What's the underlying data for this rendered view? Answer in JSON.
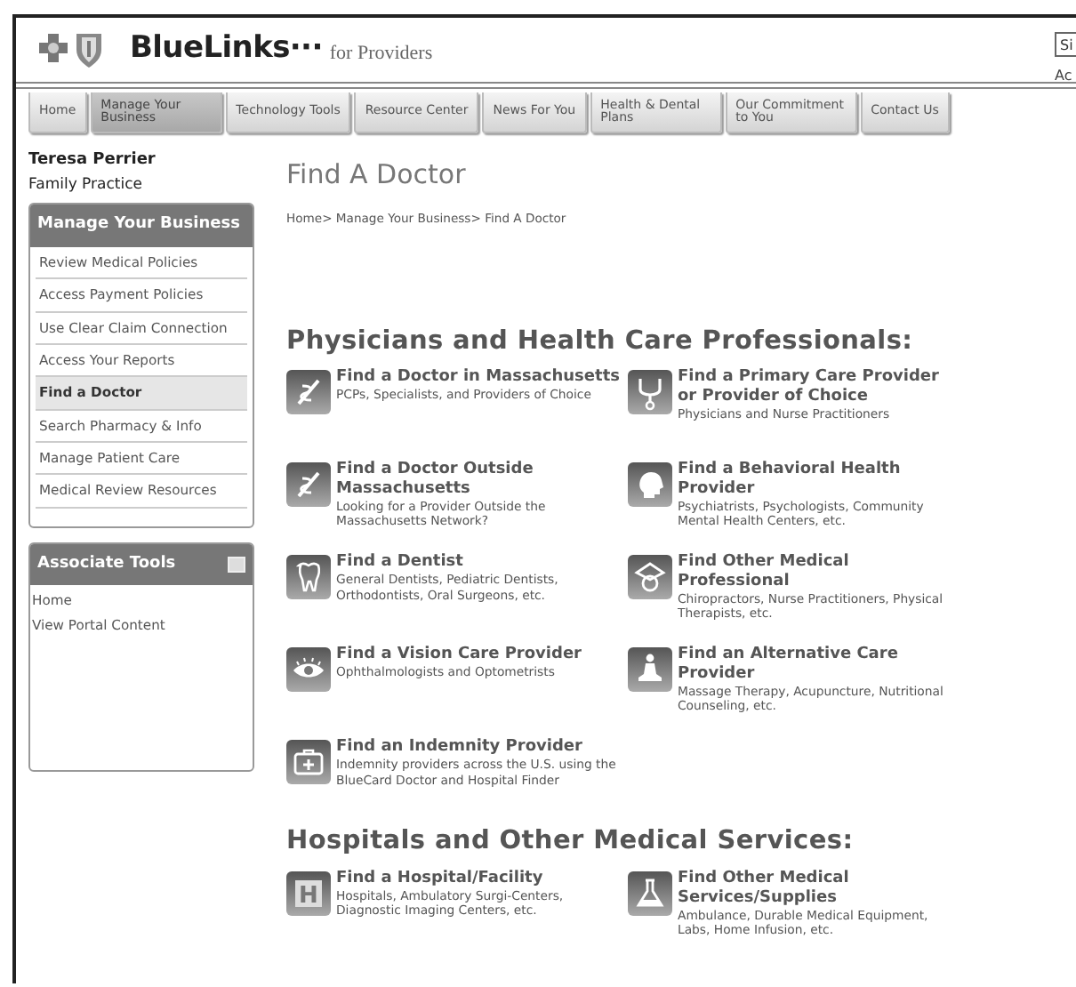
{
  "header": {
    "brand": "BlueLinks···",
    "tagline": "for Providers",
    "search_field": {
      "value": "Si"
    },
    "header_link": "Ac"
  },
  "nav": [
    {
      "label": "Home",
      "selected": false
    },
    {
      "label": "Manage Your Business",
      "selected": true
    },
    {
      "label": "Technology Tools",
      "selected": false
    },
    {
      "label": "Resource Center",
      "selected": false
    },
    {
      "label": "News For You",
      "selected": false
    },
    {
      "label": "Health & Dental Plans",
      "selected": false
    },
    {
      "label": "Our Commitment to You",
      "selected": false
    },
    {
      "label": "Contact Us",
      "selected": false
    }
  ],
  "user": {
    "name": "Teresa Perrier",
    "practice": "Family Practice"
  },
  "sidebar_panels": [
    {
      "title": "Manage Your Business",
      "collapsible": false,
      "items": [
        {
          "label": "Review Medical Policies",
          "selected": false
        },
        {
          "label": "Access Payment Policies",
          "selected": false
        },
        {
          "label": "Use Clear Claim Connection",
          "selected": false
        },
        {
          "label": "Access Your Reports",
          "selected": false
        },
        {
          "label": "Find a Doctor",
          "selected": true
        },
        {
          "label": "Search Pharmacy & Info",
          "selected": false
        },
        {
          "label": "Manage Patient Care",
          "selected": false
        },
        {
          "label": "Medical Review Resources",
          "selected": false
        }
      ]
    },
    {
      "title": "Associate Tools",
      "collapsible": true,
      "items": [
        {
          "label": "Home",
          "selected": false
        },
        {
          "label": "View Portal Content",
          "selected": false
        }
      ]
    }
  ],
  "page": {
    "title": "Find A Doctor",
    "breadcrumb": "Home> Manage Your Business> Find A Doctor",
    "sections": [
      {
        "heading": "Physicians and Health Care Professionals:",
        "items": [
          {
            "title": "Find a Doctor in Massachusetts",
            "description": "PCPs, Specialists, and Providers of Choice"
          },
          {
            "title": "Find a Primary Care Provider or Provider of Choice",
            "description": "Physicians and Nurse Practitioners"
          },
          {
            "title": "Find a Doctor Outside Massachusetts",
            "description": "Looking for a Provider Outside the Massachusetts Network?"
          },
          {
            "title": "Find a Behavioral Health Provider",
            "description": "Psychiatrists, Psychologists, Community Mental Health Centers, etc."
          },
          {
            "title": "Find a Dentist",
            "description": "General Dentists, Pediatric Dentists, Orthodontists, Oral Surgeons, etc."
          },
          {
            "title": "Find Other Medical Professional",
            "description": "Chiropractors, Nurse Practitioners, Physical Therapists, etc."
          },
          {
            "title": "Find a Vision Care Provider",
            "description": "Ophthalmologists and Optometrists"
          },
          {
            "title": "Find an Alternative Care Provider",
            "description": "Massage Therapy, Acupuncture, Nutritional Counseling, etc."
          },
          {
            "title": "Find an Indemnity Provider",
            "description": "Indemnity providers across the U.S. using the BlueCard Doctor and Hospital Finder"
          }
        ]
      },
      {
        "heading": "Hospitals and Other Medical Services:",
        "items": [
          {
            "title": "Find a Hospital/Facility",
            "description": "Hospitals, Ambulatory Surgi-Centers, Diagnostic Imaging Centers, etc.",
            "icon_text": "H"
          },
          {
            "title": "Find Other Medical Services/Supplies",
            "description": "Ambulance, Durable Medical Equipment, Labs, Home Infusion, etc."
          }
        ]
      }
    ]
  }
}
